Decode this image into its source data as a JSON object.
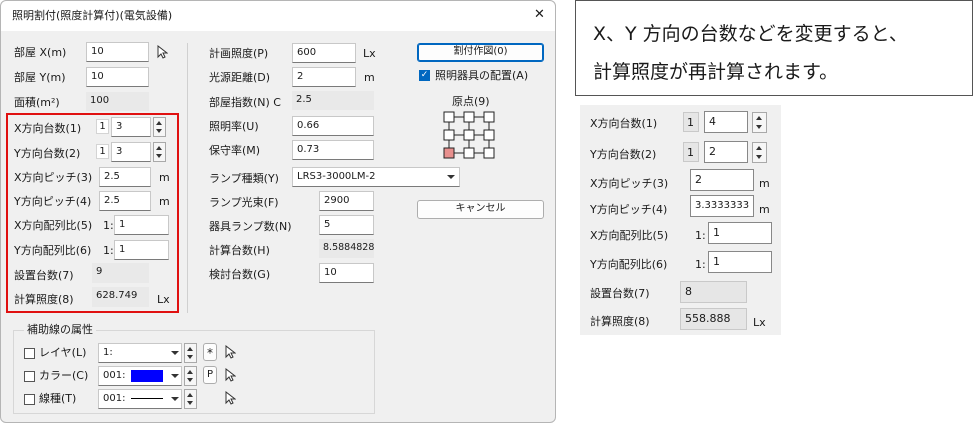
{
  "dialog": {
    "title": "照明割付(照度計算付)(電気設備)",
    "close_glyph": "✕",
    "left": {
      "room_x_label": "部屋 X(m)",
      "room_x_value": "10",
      "room_y_label": "部屋 Y(m)",
      "room_y_value": "10",
      "area_label": "面積(m²)",
      "area_value": "100",
      "x_count_label": "X方向台数(1)",
      "x_count_num": "1",
      "x_count_value": "3",
      "y_count_label": "Y方向台数(2)",
      "y_count_num": "1",
      "y_count_value": "3",
      "x_pitch_label": "X方向ピッチ(3)",
      "x_pitch_value": "2.5",
      "x_pitch_unit": "m",
      "y_pitch_label": "Y方向ピッチ(4)",
      "y_pitch_value": "2.5",
      "y_pitch_unit": "m",
      "x_ratio_label": "X方向配列比(5)",
      "x_ratio_prefix": "1:",
      "x_ratio_value": "1",
      "y_ratio_label": "Y方向配列比(6)",
      "y_ratio_prefix": "1:",
      "y_ratio_value": "1",
      "total_label": "設置台数(7)",
      "total_value": "9",
      "illum_label": "計算照度(8)",
      "illum_value": "628.749",
      "illum_unit": "Lx"
    },
    "middle": {
      "plan_illum_label": "計画照度(P)",
      "plan_illum_value": "600",
      "plan_illum_unit": "Lx",
      "light_dist_label": "光源距離(D)",
      "light_dist_value": "2",
      "light_dist_unit": "m",
      "room_index_label": "部屋指数(N) C",
      "room_index_value": "2.5",
      "util_label": "照明率(U)",
      "util_value": "0.66",
      "maint_label": "保守率(M)",
      "maint_value": "0.73",
      "lamp_type_label": "ランプ種類(Y)",
      "lamp_type_value": "LRS3-3000LM-2",
      "lamp_flux_label": "ランプ光束(F)",
      "lamp_flux_value": "2900",
      "lamps_per_label": "器具ランプ数(N)",
      "lamps_per_value": "5",
      "calc_count_label": "計算台数(H)",
      "calc_count_value": "8.5884828",
      "review_count_label": "検討台数(G)",
      "review_count_value": "10"
    },
    "right": {
      "layout_button": "割付作図(0)",
      "place_checkbox_label": "照明器具の配置(A)",
      "origin_label": "原点(9)",
      "cancel_button": "キャンセル"
    },
    "aux": {
      "group_title": "補助線の属性",
      "layer_label": "レイヤ(L)",
      "layer_value": "1:",
      "color_label": "カラー(C)",
      "color_value": "001:",
      "color_swatch": "#0000ff",
      "linetype_label": "線種(T)",
      "linetype_value": "001:",
      "star_glyph": "*",
      "p_glyph": "P"
    },
    "accent": "#e01010"
  },
  "callout": {
    "line1": "X、Y 方向の台数などを変更すると、",
    "line2": "計算照度が再計算されます。"
  },
  "zoom": {
    "x_count_label": "X方向台数(1)",
    "x_count_num": "1",
    "x_count_value": "4",
    "y_count_label": "Y方向台数(2)",
    "y_count_num": "1",
    "y_count_value": "2",
    "x_pitch_label": "X方向ピッチ(3)",
    "x_pitch_value": "2",
    "x_pitch_unit": "m",
    "y_pitch_label": "Y方向ピッチ(4)",
    "y_pitch_value": "3.3333333",
    "y_pitch_unit": "m",
    "x_ratio_label": "X方向配列比(5)",
    "x_ratio_prefix": "1:",
    "x_ratio_value": "1",
    "y_ratio_label": "Y方向配列比(6)",
    "y_ratio_prefix": "1:",
    "y_ratio_value": "1",
    "total_label": "設置台数(7)",
    "total_value": "8",
    "illum_label": "計算照度(8)",
    "illum_value": "558.888",
    "illum_unit": "Lx"
  }
}
